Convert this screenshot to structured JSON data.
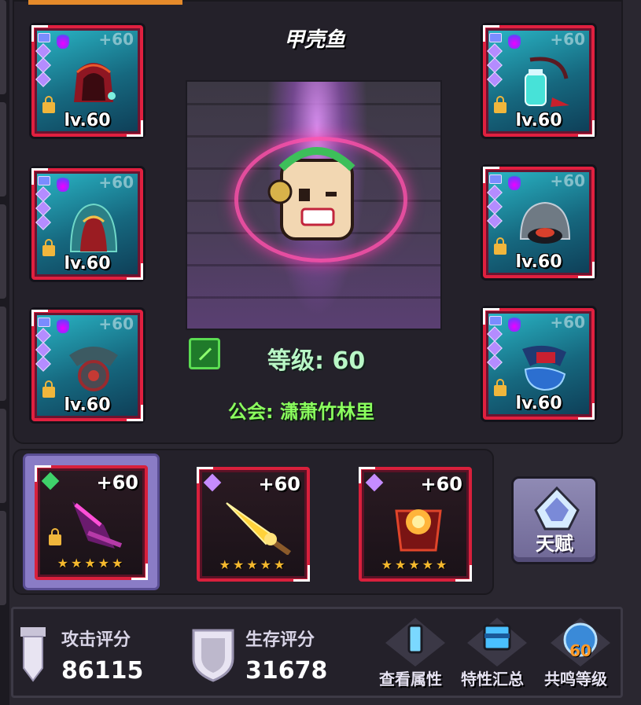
{
  "character": {
    "name": "甲壳鱼",
    "level_text": "等级: 60",
    "guild_text": "公会: 潇萧竹林里"
  },
  "equipment_left": [
    {
      "icon": "red-hood-helmet-icon",
      "plus": "+60",
      "level": "lv.60"
    },
    {
      "icon": "red-robe-armor-icon",
      "plus": "+60",
      "level": "lv.60"
    },
    {
      "icon": "dark-amulet-icon",
      "plus": "+60",
      "level": "lv.60"
    }
  ],
  "equipment_right": [
    {
      "icon": "potion-relic-icon",
      "plus": "+60",
      "level": "lv.60"
    },
    {
      "icon": "stone-bell-icon",
      "plus": "+60",
      "level": "lv.60"
    },
    {
      "icon": "blue-boots-icon",
      "plus": "+60",
      "level": "lv.60"
    }
  ],
  "weapons": [
    {
      "icon": "purple-claw-weapon-icon",
      "plus": "+60",
      "stars": "★★★★★",
      "gem_color": "#3fd16a",
      "selected": true
    },
    {
      "icon": "golden-spear-weapon-icon",
      "plus": "+60",
      "stars": "★★★★★",
      "gem_color": "#c58cff",
      "selected": false
    },
    {
      "icon": "fire-shield-weapon-icon",
      "plus": "+60",
      "stars": "★★★★★",
      "gem_color": "#c58cff",
      "selected": false
    }
  ],
  "talent": {
    "label": "天赋"
  },
  "stats": {
    "attack_label": "攻击评分",
    "attack_value": "86115",
    "survival_label": "生存评分",
    "survival_value": "31678"
  },
  "actions": {
    "view_attributes": "查看属性",
    "traits_summary": "特性汇总",
    "resonance_level": "共鸣等级",
    "resonance_value": "60"
  },
  "colors": {
    "frame_red": "#e0203f",
    "level_green": "#b9f7c6",
    "guild_green": "#8bff5e",
    "star_gold": "#f5b82e"
  }
}
